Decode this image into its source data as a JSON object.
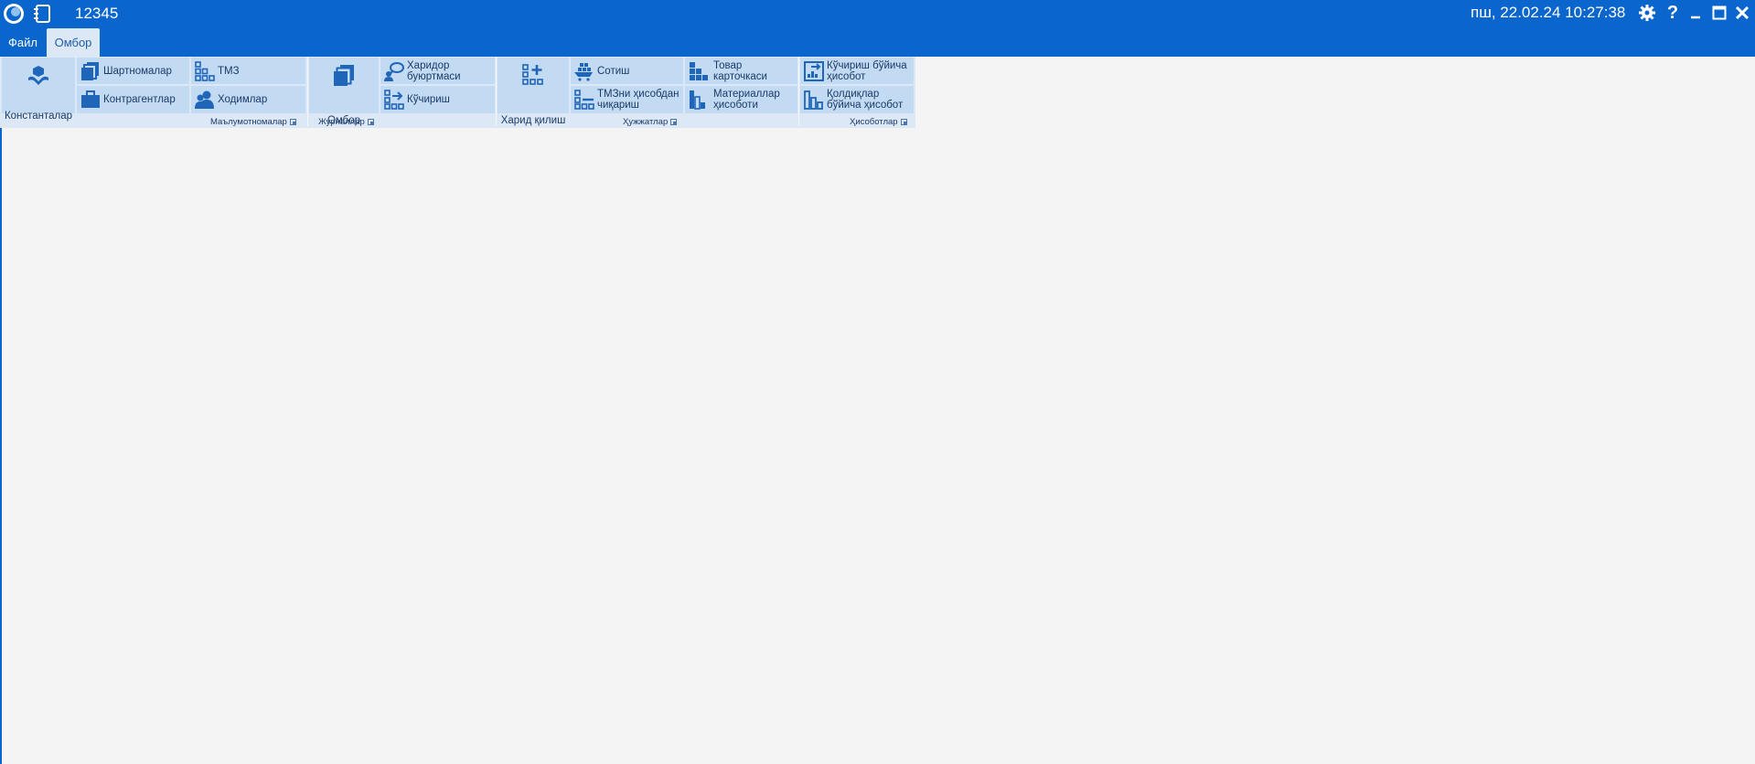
{
  "titlebar": {
    "app_title": "12345",
    "datetime": "пш, 22.02.24 10:27:38",
    "icons": [
      "app-logo-icon",
      "notebook-icon",
      "gear-icon",
      "help-icon",
      "minimize-icon",
      "maximize-icon",
      "close-icon"
    ]
  },
  "tabs": [
    {
      "label": "Файл"
    },
    {
      "label": "Омбор"
    }
  ],
  "ribbon": {
    "groups": {
      "reference": "Маълумотномалар",
      "journals": "Журналлар",
      "documents": "Ҳужжатлар",
      "reports": "Ҳисоботлар"
    },
    "buttons": {
      "constants": "Константалар",
      "contracts": "Шартномалар",
      "counterparties": "Контрагентлар",
      "tmz": "ТМЗ",
      "employees": "Ходимлар",
      "warehouse": "Омбор",
      "purchase_order": "Харидор буюртмаси",
      "transfer": "Кўчириш",
      "purchase": "Харид қилиш",
      "sale": "Сотиш",
      "tmz_writeoff": "ТМЗни ҳисобдан чиқариш",
      "product_card": "Товар карточкаси",
      "materials_report": "Материаллар ҳисоботи",
      "transfer_report": "Кўчириш бўйича ҳисобот",
      "balances_report": "Қолдиқлар бўйича ҳисобот"
    }
  },
  "colors": {
    "titlebar": "#0a66cc",
    "ribbon": "#dce8f6",
    "button": "#c3daf3",
    "text": "#1a3a68",
    "icon": "#1f66b8"
  }
}
